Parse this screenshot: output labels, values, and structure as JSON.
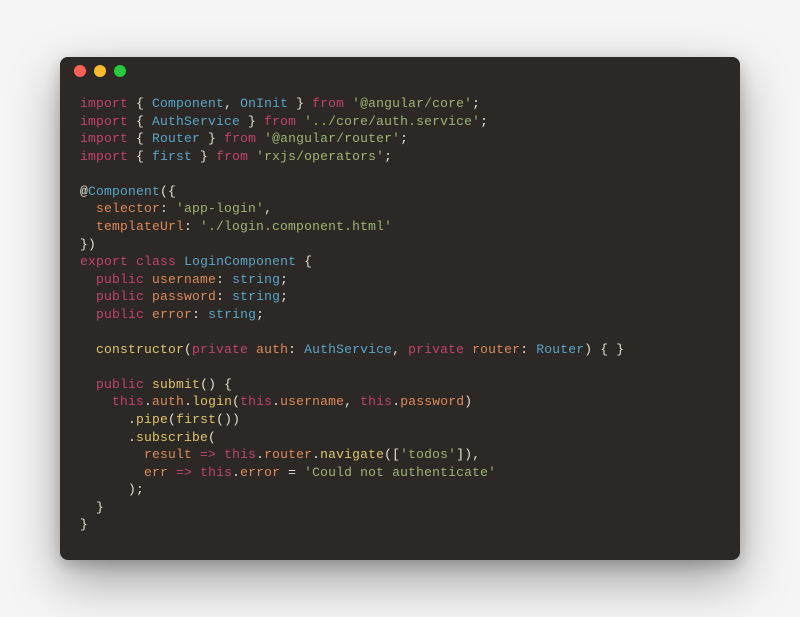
{
  "code": {
    "l1": {
      "kw1": "import",
      "p1": " { ",
      "n1": "Component",
      "p2": ", ",
      "n2": "OnInit",
      "p3": " } ",
      "kw2": "from",
      "p4": " ",
      "s": "'@angular/core'",
      "p5": ";"
    },
    "l2": {
      "kw1": "import",
      "p1": " { ",
      "n1": "AuthService",
      "p2": " } ",
      "kw2": "from",
      "p3": " ",
      "s": "'../core/auth.service'",
      "p4": ";"
    },
    "l3": {
      "kw1": "import",
      "p1": " { ",
      "n1": "Router",
      "p2": " } ",
      "kw2": "from",
      "p3": " ",
      "s": "'@angular/router'",
      "p4": ";"
    },
    "l4": {
      "kw1": "import",
      "p1": " { ",
      "n1": "first",
      "p2": " } ",
      "kw2": "from",
      "p3": " ",
      "s": "'rxjs/operators'",
      "p4": ";"
    },
    "l6": {
      "p1": "@",
      "n1": "Component",
      "p2": "({"
    },
    "l7": {
      "ind": "  ",
      "k": "selector",
      "p1": ": ",
      "s": "'app-login'",
      "p2": ","
    },
    "l8": {
      "ind": "  ",
      "k": "templateUrl",
      "p1": ": ",
      "s": "'./login.component.html'"
    },
    "l9": {
      "p1": "})"
    },
    "l10": {
      "kw1": "export",
      "sp": " ",
      "kw2": "class",
      "sp2": " ",
      "n1": "LoginComponent",
      "p1": " {"
    },
    "l11": {
      "ind": "  ",
      "kw": "public",
      "sp": " ",
      "k": "username",
      "p1": ": ",
      "ty": "string",
      "p2": ";"
    },
    "l12": {
      "ind": "  ",
      "kw": "public",
      "sp": " ",
      "k": "password",
      "p1": ": ",
      "ty": "string",
      "p2": ";"
    },
    "l13": {
      "ind": "  ",
      "kw": "public",
      "sp": " ",
      "k": "error",
      "p1": ": ",
      "ty": "string",
      "p2": ";"
    },
    "l15": {
      "ind": "  ",
      "m": "constructor",
      "p1": "(",
      "kw1": "private",
      "sp1": " ",
      "k1": "auth",
      "p2": ": ",
      "ty1": "AuthService",
      "p3": ", ",
      "kw2": "private",
      "sp2": " ",
      "k2": "router",
      "p4": ": ",
      "ty2": "Router",
      "p5": ") { }"
    },
    "l17": {
      "ind": "  ",
      "kw": "public",
      "sp": " ",
      "m": "submit",
      "p1": "() {"
    },
    "l18": {
      "ind": "    ",
      "kw1": "this",
      "p1": ".",
      "k1": "auth",
      "p2": ".",
      "m1": "login",
      "p3": "(",
      "kw2": "this",
      "p4": ".",
      "k2": "username",
      "p5": ", ",
      "kw3": "this",
      "p6": ".",
      "k3": "password",
      "p7": ")"
    },
    "l19": {
      "ind": "      ",
      "p1": ".",
      "m1": "pipe",
      "p2": "(",
      "m2": "first",
      "p3": "())"
    },
    "l20": {
      "ind": "      ",
      "p1": ".",
      "m1": "subscribe",
      "p2": "("
    },
    "l21": {
      "ind": "        ",
      "k1": "result",
      "sp1": " ",
      "ar": "=>",
      "sp2": " ",
      "kw1": "this",
      "p1": ".",
      "k2": "router",
      "p2": ".",
      "m1": "navigate",
      "p3": "([",
      "s": "'todos'",
      "p4": "]),"
    },
    "l22": {
      "ind": "        ",
      "k1": "err",
      "sp1": " ",
      "ar": "=>",
      "sp2": " ",
      "kw1": "this",
      "p1": ".",
      "k2": "error",
      "p2": " = ",
      "s": "'Could not authenticate'"
    },
    "l23": {
      "ind": "      ",
      "p1": ");"
    },
    "l24": {
      "ind": "  ",
      "p1": "}"
    },
    "l25": {
      "p1": "}"
    }
  }
}
